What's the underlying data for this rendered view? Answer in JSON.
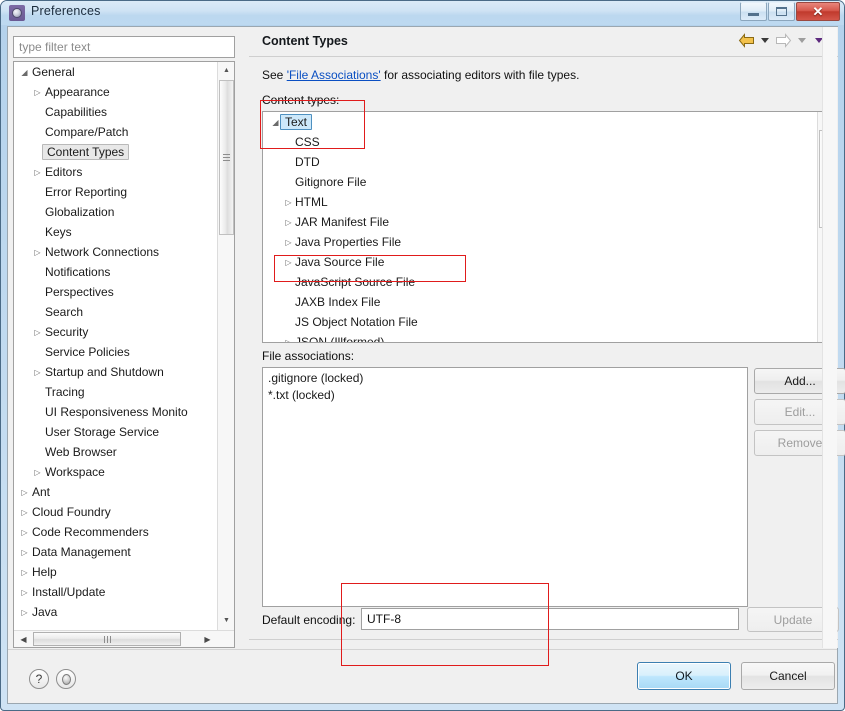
{
  "window": {
    "title": "Preferences",
    "icon": "gear-icon",
    "minimize_label": "",
    "maximize_label": "",
    "close_label": "✕"
  },
  "sidebar": {
    "filter": {
      "placeholder": "type filter text",
      "value": ""
    },
    "items": [
      {
        "label": "General",
        "indent": 0,
        "twisty": "expanded",
        "selected": false
      },
      {
        "label": "Appearance",
        "indent": 1,
        "twisty": "collapsed",
        "selected": false
      },
      {
        "label": "Capabilities",
        "indent": 1,
        "twisty": "none",
        "selected": false
      },
      {
        "label": "Compare/Patch",
        "indent": 1,
        "twisty": "none",
        "selected": false
      },
      {
        "label": "Content Types",
        "indent": 1,
        "twisty": "none",
        "selected": true
      },
      {
        "label": "Editors",
        "indent": 1,
        "twisty": "collapsed",
        "selected": false
      },
      {
        "label": "Error Reporting",
        "indent": 1,
        "twisty": "none",
        "selected": false
      },
      {
        "label": "Globalization",
        "indent": 1,
        "twisty": "none",
        "selected": false
      },
      {
        "label": "Keys",
        "indent": 1,
        "twisty": "none",
        "selected": false
      },
      {
        "label": "Network Connections",
        "indent": 1,
        "twisty": "collapsed",
        "selected": false
      },
      {
        "label": "Notifications",
        "indent": 1,
        "twisty": "none",
        "selected": false
      },
      {
        "label": "Perspectives",
        "indent": 1,
        "twisty": "none",
        "selected": false
      },
      {
        "label": "Search",
        "indent": 1,
        "twisty": "none",
        "selected": false
      },
      {
        "label": "Security",
        "indent": 1,
        "twisty": "collapsed",
        "selected": false
      },
      {
        "label": "Service Policies",
        "indent": 1,
        "twisty": "none",
        "selected": false
      },
      {
        "label": "Startup and Shutdown",
        "indent": 1,
        "twisty": "collapsed",
        "selected": false
      },
      {
        "label": "Tracing",
        "indent": 1,
        "twisty": "none",
        "selected": false
      },
      {
        "label": "UI Responsiveness Monito",
        "indent": 1,
        "twisty": "none",
        "selected": false
      },
      {
        "label": "User Storage Service",
        "indent": 1,
        "twisty": "none",
        "selected": false
      },
      {
        "label": "Web Browser",
        "indent": 1,
        "twisty": "none",
        "selected": false
      },
      {
        "label": "Workspace",
        "indent": 1,
        "twisty": "collapsed",
        "selected": false
      },
      {
        "label": "Ant",
        "indent": 0,
        "twisty": "collapsed",
        "selected": false
      },
      {
        "label": "Cloud Foundry",
        "indent": 0,
        "twisty": "collapsed",
        "selected": false
      },
      {
        "label": "Code Recommenders",
        "indent": 0,
        "twisty": "collapsed",
        "selected": false
      },
      {
        "label": "Data Management",
        "indent": 0,
        "twisty": "collapsed",
        "selected": false
      },
      {
        "label": "Help",
        "indent": 0,
        "twisty": "collapsed",
        "selected": false
      },
      {
        "label": "Install/Update",
        "indent": 0,
        "twisty": "collapsed",
        "selected": false
      },
      {
        "label": "Java",
        "indent": 0,
        "twisty": "collapsed",
        "selected": false
      }
    ]
  },
  "page": {
    "title": "Content Types",
    "nav": {
      "back_icon": "arrow-left-icon",
      "back_dropdown_icon": "chevron-down-icon",
      "forward_icon": "arrow-right-icon",
      "forward_dropdown_icon": "chevron-down-icon",
      "menu_icon": "chevron-down-icon"
    },
    "description_prefix": "See ",
    "description_link": "'File Associations'",
    "description_suffix": " for associating editors with file types.",
    "content_types_label": "Content types:",
    "content_types": [
      {
        "label": "Text",
        "indent": 0,
        "twisty": "expanded",
        "selected": true
      },
      {
        "label": "CSS",
        "indent": 1,
        "twisty": "none",
        "selected": false
      },
      {
        "label": "DTD",
        "indent": 1,
        "twisty": "none",
        "selected": false
      },
      {
        "label": "Gitignore File",
        "indent": 1,
        "twisty": "none",
        "selected": false
      },
      {
        "label": "HTML",
        "indent": 1,
        "twisty": "collapsed",
        "selected": false
      },
      {
        "label": "JAR Manifest File",
        "indent": 1,
        "twisty": "collapsed",
        "selected": false
      },
      {
        "label": "Java Properties File",
        "indent": 1,
        "twisty": "collapsed",
        "selected": false
      },
      {
        "label": "Java Source File",
        "indent": 1,
        "twisty": "collapsed",
        "selected": false
      },
      {
        "label": "JavaScript Source File",
        "indent": 1,
        "twisty": "none",
        "selected": false
      },
      {
        "label": "JAXB Index File",
        "indent": 1,
        "twisty": "none",
        "selected": false
      },
      {
        "label": "JS Object Notation File",
        "indent": 1,
        "twisty": "none",
        "selected": false
      },
      {
        "label": "JSON (Illformed)",
        "indent": 1,
        "twisty": "collapsed",
        "selected": false
      }
    ],
    "file_associations_label": "File associations:",
    "file_associations": [
      ".gitignore (locked)",
      "*.txt (locked)"
    ],
    "buttons": {
      "add": "Add...",
      "edit": "Edit...",
      "remove": "Remove",
      "update": "Update"
    },
    "encoding": {
      "label": "Default encoding:",
      "value": "UTF-8",
      "placeholder": ""
    }
  },
  "footer": {
    "help_icon": "question-mark-icon",
    "secondary_icon": "circle-icon",
    "ok": "OK",
    "cancel": "Cancel"
  },
  "colors": {
    "annotation": "#e01b1b",
    "selection_fill": "#cde8fa",
    "selection_border": "#4e90c0",
    "link": "#0a4fc2",
    "ok_border": "#3c7fb1",
    "titlebar": "#cfe3f4",
    "close_button": "#c03a2d"
  },
  "annotations": [
    {
      "name": "text-node-highlight"
    },
    {
      "name": "java-source-file-highlight"
    },
    {
      "name": "default-encoding-highlight"
    }
  ]
}
